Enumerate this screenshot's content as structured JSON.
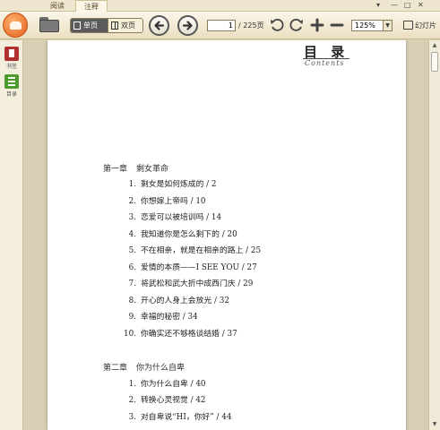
{
  "tabs": [
    {
      "label": "阅读"
    },
    {
      "label": "注释"
    }
  ],
  "window_controls": [
    "▾",
    "—",
    "□",
    "✕"
  ],
  "toolbar": {
    "single_page": "单页",
    "double_page": "双页",
    "current_page": "1",
    "total_pages": "/ 225页",
    "zoom": "125%",
    "slideshow": "幻灯片"
  },
  "sidebar": {
    "items": [
      {
        "label": "书签"
      },
      {
        "label": "目录"
      }
    ]
  },
  "document": {
    "title": "目  录",
    "subtitle": "Contents",
    "chapters": [
      {
        "number": "第一章",
        "title": "剩女革命",
        "entries": [
          {
            "num": "1.",
            "text": "剩女是如何炼成的 / 2"
          },
          {
            "num": "2.",
            "text": "你想嫁上帝吗 / 10"
          },
          {
            "num": "3.",
            "text": "恋爱可以被培训吗 / 14"
          },
          {
            "num": "4.",
            "text": "我知道你是怎么剩下的 / 20"
          },
          {
            "num": "5.",
            "text": "不在相亲，就是在相亲的路上 / 25"
          },
          {
            "num": "6.",
            "text": "爱情的本质——I SEE YOU / 27"
          },
          {
            "num": "7.",
            "text": "将武松和武大折中成西门庆 / 29"
          },
          {
            "num": "8.",
            "text": "开心的人身上会放光 / 32"
          },
          {
            "num": "9.",
            "text": "幸福的秘密 / 34"
          },
          {
            "num": "10.",
            "text": "你确实还不够格谈结婚 / 37"
          }
        ]
      },
      {
        "number": "第二章",
        "title": "你为什么自卑",
        "entries": [
          {
            "num": "1.",
            "text": "你为什么自卑 / 40"
          },
          {
            "num": "2.",
            "text": "转换心灵视觉 / 42"
          },
          {
            "num": "3.",
            "text": "对自卑说“HI，你好” / 44"
          }
        ]
      }
    ]
  }
}
